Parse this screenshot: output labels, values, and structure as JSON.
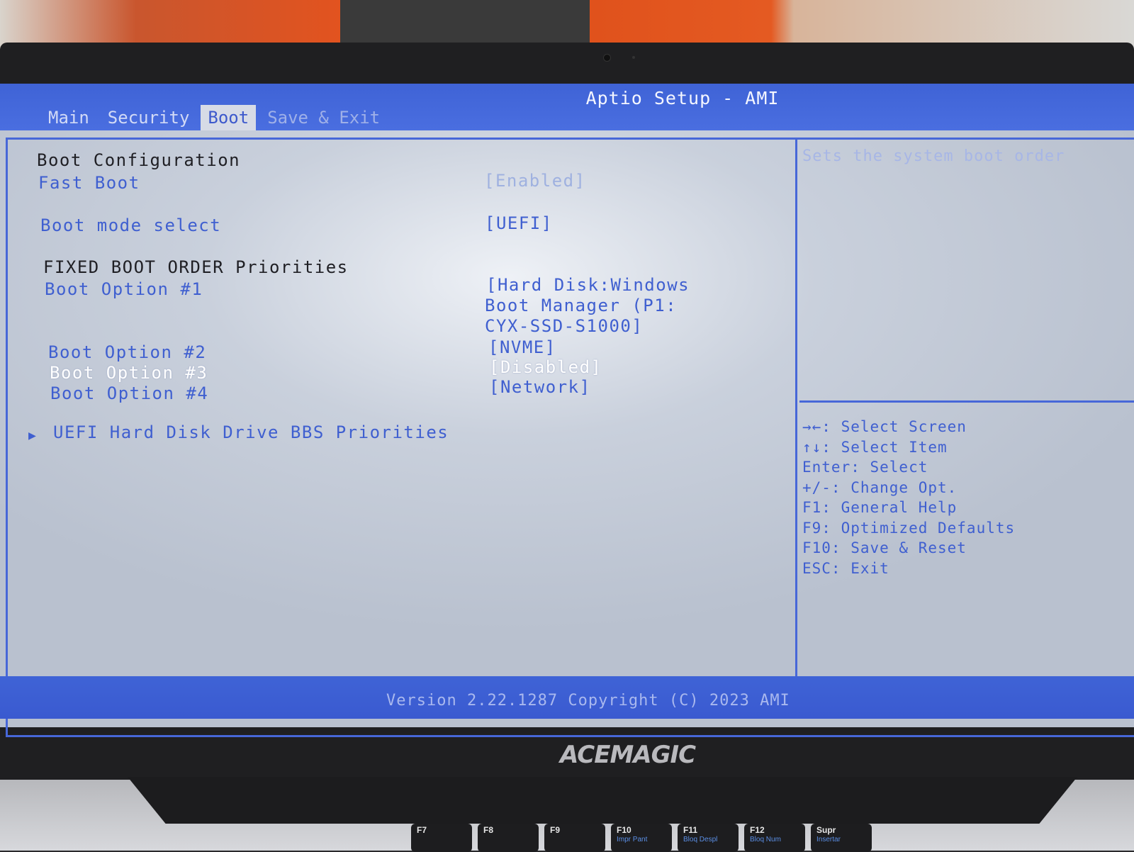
{
  "window": {
    "title": "Aptio Setup - AMI"
  },
  "tabs": [
    {
      "label": "Main"
    },
    {
      "label": "Security"
    },
    {
      "label": "Boot"
    },
    {
      "label": "Save & Exit"
    }
  ],
  "boot": {
    "section_title": "Boot Configuration",
    "fast_boot": {
      "label": "Fast Boot",
      "value": "[Enabled]"
    },
    "boot_mode": {
      "label": "Boot mode select",
      "value": "[UEFI]"
    },
    "fixed_order_title": "FIXED BOOT ORDER Priorities",
    "option1": {
      "label": "Boot Option #1",
      "value_lines": [
        "[Hard Disk:Windows",
        "Boot Manager (P1:",
        "CYX-SSD-S1000]"
      ]
    },
    "option2": {
      "label": "Boot Option #2",
      "value": "[NVME]"
    },
    "option3": {
      "label": "Boot Option #3",
      "value": "[Disabled]"
    },
    "option4": {
      "label": "Boot Option #4",
      "value": "[Network]"
    },
    "uefi_bbs": {
      "label": "UEFI Hard Disk Drive BBS Priorities"
    }
  },
  "help": {
    "description": "Sets the system boot order",
    "keys": [
      "→←: Select Screen",
      "↑↓: Select Item",
      "Enter: Select",
      "+/-: Change Opt.",
      "F1: General Help",
      "F9: Optimized Defaults",
      "F10: Save & Reset",
      "ESC: Exit"
    ]
  },
  "footer": {
    "version": "Version 2.22.1287 Copyright (C) 2023 AMI"
  },
  "hardware": {
    "brand": "ACEMAGIC",
    "function_keys": [
      {
        "key": "F7",
        "sub": ""
      },
      {
        "key": "F8",
        "sub": ""
      },
      {
        "key": "F9",
        "sub": ""
      },
      {
        "key": "F10",
        "sub": "Impr Pant"
      },
      {
        "key": "F11",
        "sub": "Bloq Despl"
      },
      {
        "key": "F12",
        "sub": "Bloq Num"
      },
      {
        "key": "Supr",
        "sub": "Insertar"
      }
    ]
  },
  "colors": {
    "bios_blue": "#4767d8",
    "bios_text_blue": "#3f5fd0",
    "selected_text": "#ffffff"
  }
}
